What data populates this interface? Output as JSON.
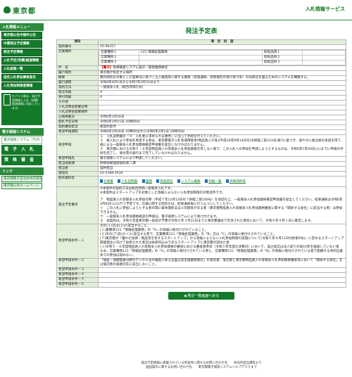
{
  "header": {
    "logo_text": "東京都",
    "site_title": "入札情報サービス"
  },
  "sidebar": {
    "menu_head": "入札情報メニュー",
    "menu_items": [
      "東京都公告中案件公告",
      "中間発注予定情報",
      "発注予定情報",
      "入札予定(見積)経過情報",
      "入札結果一覧",
      "指名入札参加資格者名",
      "入札参加制限者情報"
    ],
    "mobile_text": "モバイル版は、発注予定情報と入札（見積）経過情報に対応しています。",
    "sub_head": "電子調達システム",
    "sub_items": [
      "電子調達システム（TOP）"
    ],
    "big_buttons": [
      "電　子　入　札",
      "資　格　審　査"
    ],
    "links_head": "リンク",
    "links": [
      "東京都電子自治体共同運営",
      "東京都公式ホームページ"
    ]
  },
  "page": {
    "title": "発注予定表"
  },
  "table": {
    "head_col1": "項目",
    "head_col2": "項　目　内　容",
    "rows": [
      {
        "label": "契約番号",
        "value": "05-06257"
      },
      {
        "label": "営業種目",
        "value": ""
      },
      {
        "label": "件　名",
        "value": ""
      },
      {
        "label": "履行場所",
        "value": "東京都が指定する場所"
      },
      {
        "label": "概要",
        "value": "都内病院を対象とした医療法に基づく立入検査等に関する業務（実施通知、改善報告の受け取り等）の効率化を図るためのシステムを構築する。"
      },
      {
        "label": "履行期間",
        "value": "令和6年4月1日から令和7年3月31日まで"
      },
      {
        "label": "契約方法",
        "value": "一般競争入札（総合評価方式）"
      },
      {
        "label": "発注等級",
        "value": "A"
      },
      {
        "label": "受付等級",
        "value": "A"
      },
      {
        "label": "その他",
        "value": ""
      },
      {
        "label": "入札説明会開催日時",
        "value": ""
      },
      {
        "label": "入札説明会開催場所",
        "value": ""
      },
      {
        "label": "公報掲載日",
        "value": "令和6年1月26日"
      },
      {
        "label": "開札予定日時",
        "value": "令和6年3月15日 10時00分"
      },
      {
        "label": "契約審査担当",
        "value": "総契約案件"
      },
      {
        "label": "希望申請期間",
        "value": "令和6年1月26日 10時00分から令和6年2月1日 16時00分"
      },
      {
        "label": "希望申請先",
        "value": "電子調達システムにより申請してください。"
      },
      {
        "label": "担当局部課",
        "value": "財務局経理部契約第二課"
      },
      {
        "label": "担当者",
        "value": "契約担当"
      },
      {
        "label": "連絡先",
        "value": "03-5388-2634"
      },
      {
        "label": "配布資料等",
        "value": ""
      },
      {
        "label": "発注予定備考",
        "value": ""
      },
      {
        "label": "希望申請条件－１",
        "value": ""
      },
      {
        "label": "希望申請条件－２",
        "value": "「福祉・保健医療分野のデジタル化の推進に係る企画立案支援業務委託」の受託者、受託者と東京都物品買入れ等競争入札参加資格審査等において「関係する会社」又は受託者の再委託先に該当しないこと。"
      },
      {
        "label": "希望申請条件－３",
        "value": ""
      },
      {
        "label": "希望申請条件－４",
        "value": ""
      },
      {
        "label": "希望申請条件－５",
        "value": ""
      },
      {
        "label": "希望申請条件－６",
        "value": ""
      }
    ],
    "business": [
      {
        "label": "営業種目１",
        "value": "121 情報処理業務",
        "rank_label": "取扱品目１",
        "rank_value": ""
      },
      {
        "label": "営業種目２",
        "value": "",
        "rank_label": "取扱品目２",
        "rank_value": ""
      },
      {
        "label": "営業種目３",
        "value": "",
        "rank_label": "取扱品目３",
        "rank_value": ""
      }
    ],
    "subject_tag": "【電子】",
    "subject_text": "指導検査システム設計・開発業務委託",
    "apply_notes": [
      "１　入札説明書の「４　入札者に求められる要件」に沿って手続を行ってください。",
      "２　紙入札により参加を希望する者は、東京都電子入札等運用基準(物品買入れ等)(平成16年9月14日付16財経二第143号)第7に基づき、速やかに発注者の承諾を得て、紙による一般競争入札参加資格確認申請書を提出しなければなりません。",
      "３　東京都における令和５・６年度物品買入れ等競争入札参加資格を有しない者で、この入札への参加を申請しようとするものは、令和6年1月30日(火)までに申請の手続を完了し、受付票の発行まで完了していなければなりません。"
    ],
    "docs": [
      "仕様書",
      "入札説明書",
      "図面",
      "質疑回答",
      "システム概要",
      "別紙一覧",
      "評価項目等"
    ],
    "remarks": [
      "※本案件の契約方法は総合評価一般競争入札です。",
      "※本案件はスタートアップを対象とした等級によらない入札参加制限の対象案件です。",
      "ア　物品買入れ等競争入札参加の際（平成７年12月12日付７財経二第100号）を承認の上、一般競争入札参加資格確認申請書を提出してください。結果通知は令和6年2月6日(火)に行う予定です。仕様に関する問合せは、結果通知後に行うようにしてください。",
      "イ　この入札に参加しようとする者の間に資本関係又は人的関係がある者（東京都物品買入れ等競争入札参加資格審査に関する「関係する会社」に該当する者）は参加できません。",
      "ウ　一般競争入札参加資格確認の申請は、電子調達システムにより受け付けます。",
      "エ　本契約は、令和６年度東京都一般会計予算が令和６年３月31日までに東京都議会で可決された場合において、令和６年４月１日に確定します。"
    ],
    "conditions1": [
      "次の(１)又は(２)に該当すること。",
      "(１)業種目121「情報処理業務」の「A」の等級に格付けされていること。",
      "(２)次の(ア)及び(イ)に該当する者で、営業種目121「情報処理業務」の「B」又は「C」の等級に格付けされていること。",
      "(ア)東京都が「優れた技術・製品等を有するスタートアップ」から等級によらない入札参加制限の実施について(令和５年９月11日付財第9号)」に定めるスタートアップ関連発注に向けて採択された者又は採択見込みであるスタートアップと東京都が認めた者",
      "(イ)令和５・６年度物品買入れ等競争入札参加資格の審査における審査基準日（令和５年年度の決算日）において、設立後又は法人成りの後10年を経過していない者",
      "なお、営業種目121「情報処理業務」の「A」の等級に格付けされている者と、営業種目121「情報処理業務」の「B」の等級に格付けされている者で組織する共同企業体での参加は認めない。"
    ],
    "back_button": "発注一覧画面へ戻る"
  },
  "footer": {
    "line1": "発注予定情報に掲載されている各案件に関するお問い合わせ先　　各局所担当課等まで",
    "line2": "画面操作に関するお問い合わせ先　　東京都電子調達システムヘルプデスクまで"
  }
}
